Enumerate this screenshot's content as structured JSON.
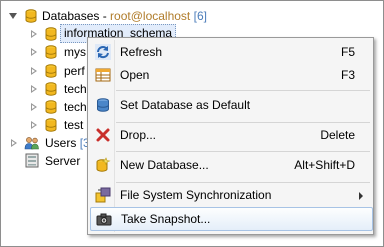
{
  "tree": {
    "root": {
      "label": "Databases",
      "separator": " - ",
      "host": "root@localhost",
      "count": "[6]"
    },
    "children": [
      {
        "label": "information_schema"
      },
      {
        "label": "mys"
      },
      {
        "label": "perf"
      },
      {
        "label": "tech"
      },
      {
        "label": "tech"
      },
      {
        "label": "test"
      }
    ],
    "users": {
      "label": "Users",
      "count": "[3"
    },
    "server": {
      "label": "Server"
    }
  },
  "context_menu": {
    "items": [
      {
        "label": "Refresh",
        "shortcut": "F5",
        "icon": "refresh-icon"
      },
      {
        "label": "Open",
        "shortcut": "F3",
        "icon": "open-table-icon"
      },
      {
        "label": "Set Database as Default",
        "shortcut": "",
        "icon": "database-icon"
      },
      {
        "label": "Drop...",
        "shortcut": "Delete",
        "icon": "delete-x-icon"
      },
      {
        "label": "New Database...",
        "shortcut": "Alt+Shift+D",
        "icon": "new-database-icon"
      },
      {
        "label": "File System Synchronization",
        "shortcut": "",
        "icon": "sync-icon",
        "submenu": true
      },
      {
        "label": "Take Snapshot...",
        "shortcut": "",
        "icon": "camera-icon"
      }
    ]
  }
}
